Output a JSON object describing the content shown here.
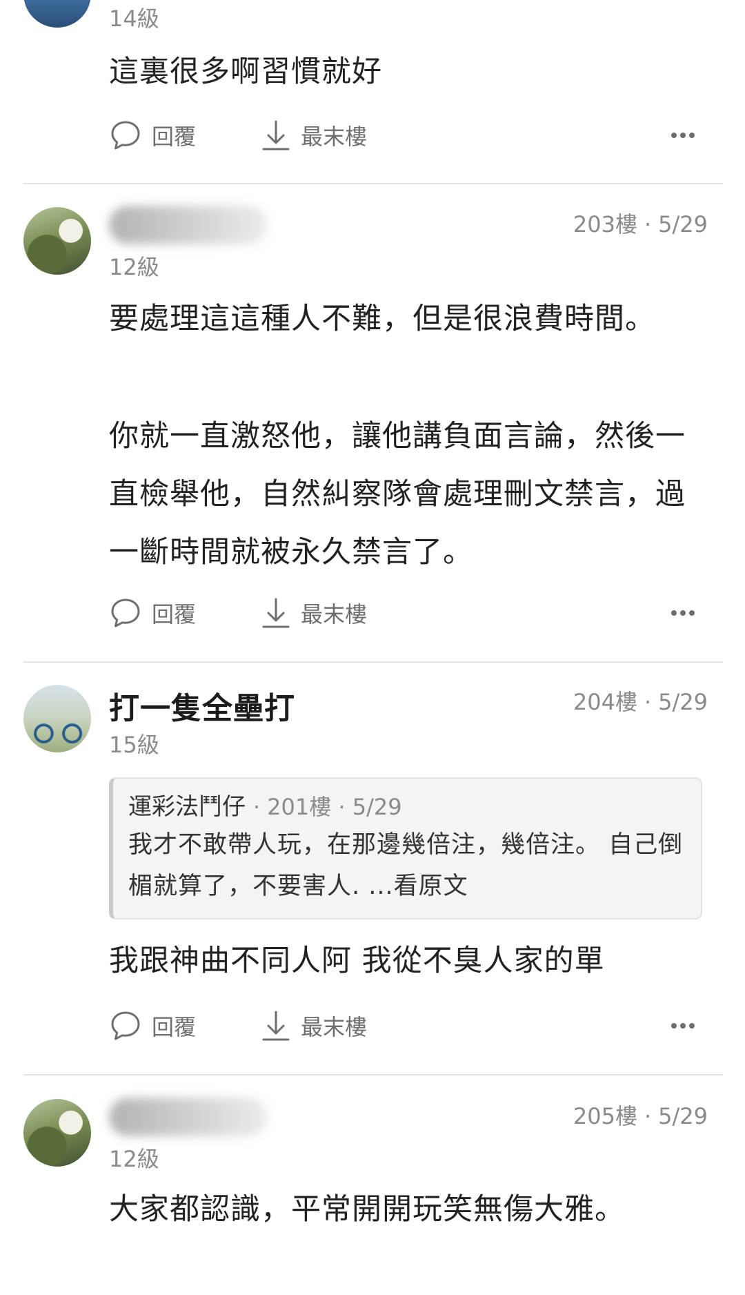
{
  "actions": {
    "reply_label": "回覆",
    "last_floor_label": "最末樓",
    "more_icon": "more-horizontal-icon"
  },
  "posts": [
    {
      "level": "14級",
      "text": "這裏很多啊習慣就好"
    },
    {
      "name_blurred": true,
      "level": "12級",
      "floor": "203樓",
      "date": "5/29",
      "paragraphs": [
        "要處理這這種人不難，但是很浪費時間。",
        "你就一直激怒他，讓他講負面言論，然後一直檢舉他，自然糾察隊會處理刪文禁言，過一斷時間就被永久禁言了。"
      ]
    },
    {
      "name": "打一隻全壘打",
      "level": "15級",
      "floor": "204樓",
      "date": "5/29",
      "quote": {
        "author": "運彩法鬥仔",
        "floor": "201樓",
        "date": "5/29",
        "text": "我才不敢帶人玩，在那邊幾倍注，幾倍注。 自己倒楣就算了，不要害人. ...看原文"
      },
      "text": "我跟神曲不同人阿 我從不臭人家的單"
    },
    {
      "name_blurred": true,
      "level": "12級",
      "floor": "205樓",
      "date": "5/29",
      "text": "大家都認識，平常開開玩笑無傷大雅。"
    }
  ]
}
